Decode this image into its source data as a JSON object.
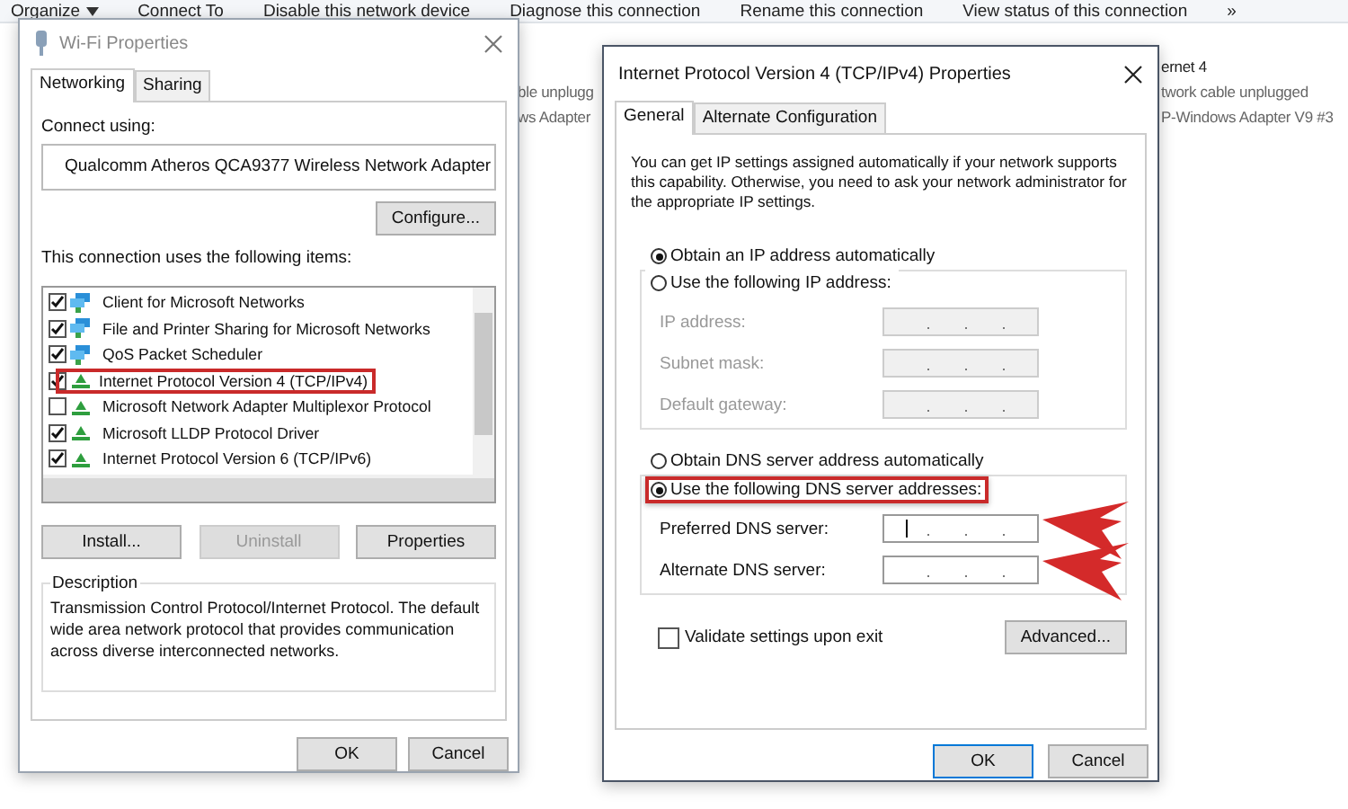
{
  "explorer": {
    "toolbar": [
      {
        "label": "Organize",
        "dropdown": true
      },
      {
        "label": "Connect To",
        "dropdown": false
      },
      {
        "label": "Disable this network device",
        "dropdown": false
      },
      {
        "label": "Diagnose this connection",
        "dropdown": false
      },
      {
        "label": "Rename this connection",
        "dropdown": false
      },
      {
        "label": "View status of this connection",
        "dropdown": false
      },
      {
        "label": "»",
        "dropdown": false
      }
    ],
    "connections": [
      {
        "lines": [
          "ble unplugg",
          "ws Adapter"
        ]
      },
      {
        "lines": [
          "ernet 4",
          "twork cable unplugged",
          "P-Windows Adapter V9 #3"
        ]
      }
    ]
  },
  "wifi_window": {
    "title": "Wi-Fi Properties",
    "active": false,
    "tabs": [
      {
        "label": "Networking",
        "selected": true
      },
      {
        "label": "Sharing",
        "selected": false
      }
    ],
    "connect_using_label": "Connect using:",
    "adapter": "Qualcomm Atheros QCA9377 Wireless Network Adapter",
    "configure_button": "Configure...",
    "items_label": "This connection uses the following items:",
    "items": [
      {
        "label": "Client for Microsoft Networks",
        "checked": true,
        "kind": "service",
        "highlighted": false
      },
      {
        "label": "File and Printer Sharing for Microsoft Networks",
        "checked": true,
        "kind": "service",
        "highlighted": false
      },
      {
        "label": "QoS Packet Scheduler",
        "checked": true,
        "kind": "service",
        "highlighted": false
      },
      {
        "label": "Internet Protocol Version 4 (TCP/IPv4)",
        "checked": true,
        "kind": "protocol",
        "highlighted": true
      },
      {
        "label": "Microsoft Network Adapter Multiplexor Protocol",
        "checked": false,
        "kind": "protocol",
        "highlighted": false
      },
      {
        "label": "Microsoft LLDP Protocol Driver",
        "checked": true,
        "kind": "protocol",
        "highlighted": false
      },
      {
        "label": "Internet Protocol Version 6 (TCP/IPv6)",
        "checked": true,
        "kind": "protocol",
        "highlighted": false
      }
    ],
    "item_buttons": [
      {
        "label": "Install...",
        "disabled": false
      },
      {
        "label": "Uninstall",
        "disabled": true
      },
      {
        "label": "Properties",
        "disabled": false
      }
    ],
    "description_title": "Description",
    "description": "Transmission Control Protocol/Internet Protocol. The default wide area network protocol that provides communication across diverse interconnected networks.",
    "buttons": [
      {
        "label": "OK",
        "default": false
      },
      {
        "label": "Cancel",
        "default": false
      }
    ]
  },
  "ipv4_window": {
    "title": "Internet Protocol Version 4 (TCP/IPv4) Properties",
    "active": true,
    "tabs": [
      {
        "label": "General",
        "selected": true
      },
      {
        "label": "Alternate Configuration",
        "selected": false
      }
    ],
    "intro": "You can get IP settings assigned automatically if your network supports this capability. Otherwise, you need to ask your network administrator for the appropriate IP settings.",
    "ip_options": [
      {
        "label": "Obtain an IP address automatically",
        "selected": true,
        "highlighted": false
      },
      {
        "label": "Use the following IP address:",
        "selected": false,
        "highlighted": false
      }
    ],
    "ip_fields": [
      {
        "label": "IP address:",
        "disabled": true,
        "pointed": false
      },
      {
        "label": "Subnet mask:",
        "disabled": true,
        "pointed": false
      },
      {
        "label": "Default gateway:",
        "disabled": true,
        "pointed": false
      }
    ],
    "dns_options": [
      {
        "label": "Obtain DNS server address automatically",
        "selected": false,
        "highlighted": false
      },
      {
        "label": "Use the following DNS server addresses:",
        "selected": true,
        "highlighted": true
      }
    ],
    "dns_fields": [
      {
        "label": "Preferred DNS server:",
        "disabled": false,
        "pointed": true
      },
      {
        "label": "Alternate DNS server:",
        "disabled": false,
        "pointed": true
      }
    ],
    "validate": {
      "label": "Validate settings upon exit",
      "checked": false
    },
    "advanced_button": "Advanced...",
    "buttons": [
      {
        "label": "OK",
        "default": true
      },
      {
        "label": "Cancel",
        "default": false
      }
    ]
  }
}
